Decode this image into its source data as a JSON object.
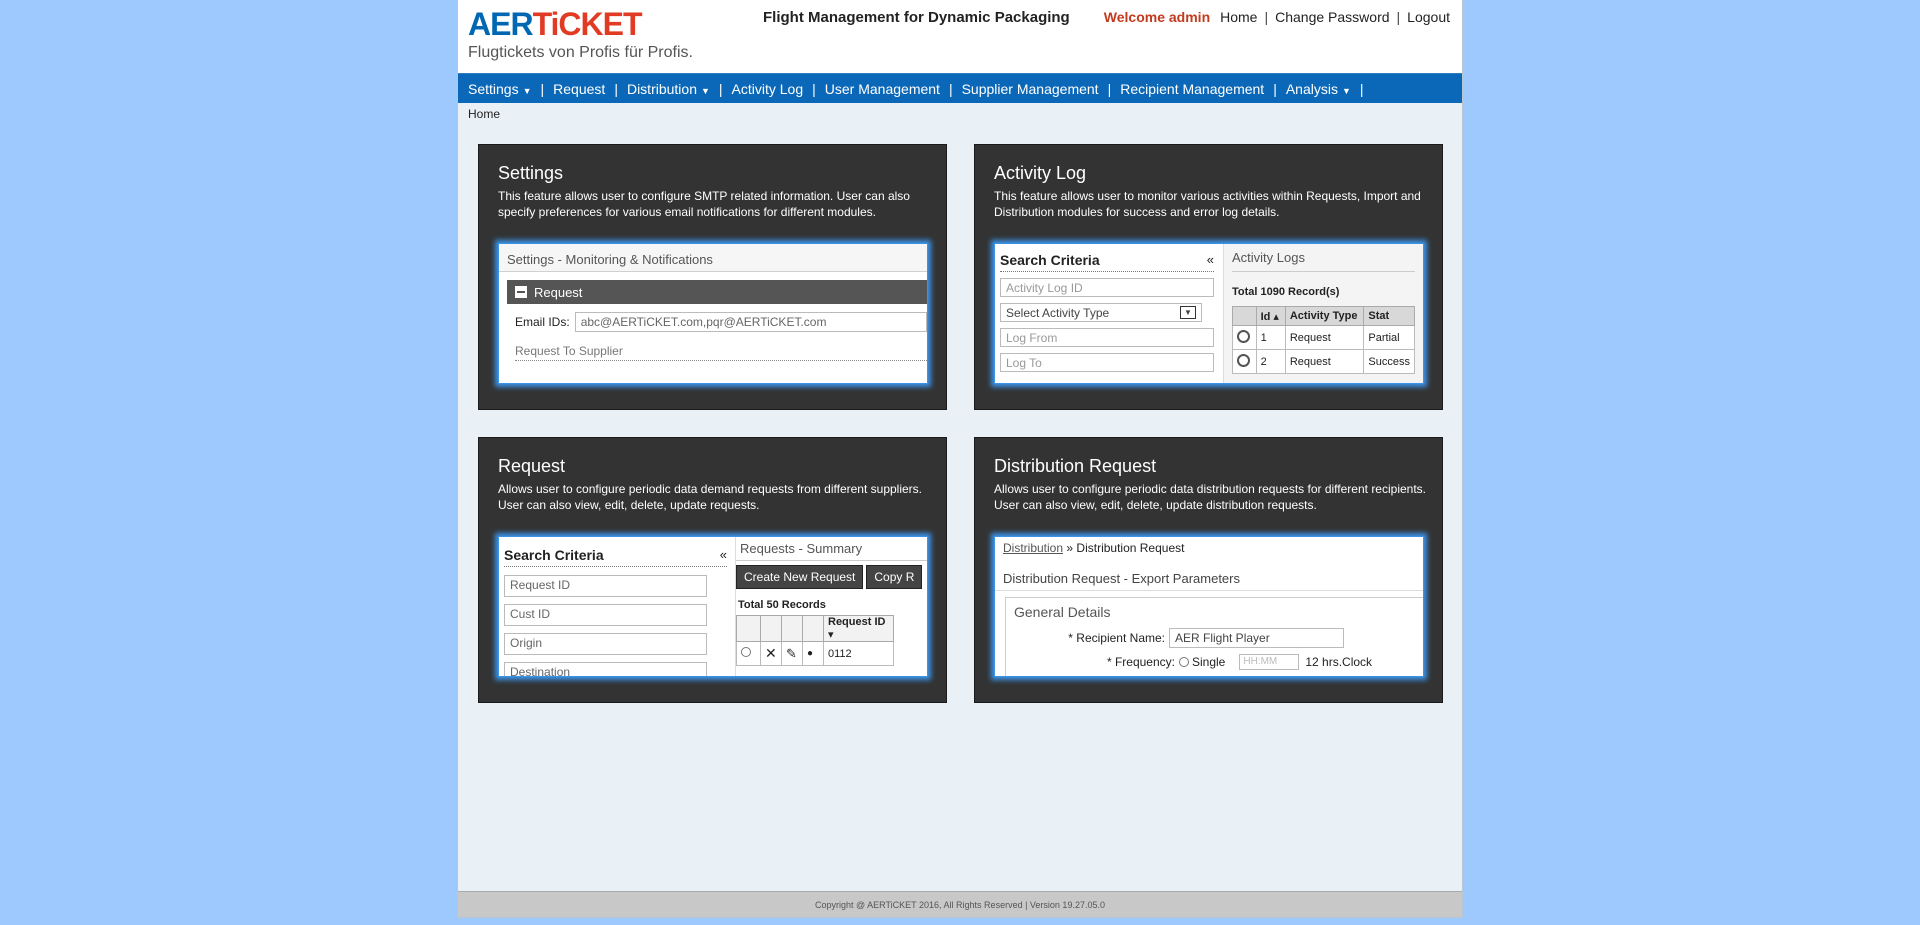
{
  "logo": {
    "word_a": "AER",
    "word_b": "TiCKET",
    "tagline": "Flugtickets von Profis für Profis."
  },
  "app_title": "Flight Management for Dynamic Packaging",
  "user_nav": {
    "welcome": "Welcome admin",
    "home": "Home",
    "change_password": "Change Password",
    "logout": "Logout"
  },
  "menu": {
    "settings": "Settings",
    "request": "Request",
    "distribution": "Distribution",
    "activity_log": "Activity Log",
    "user_management": "User Management",
    "supplier_management": "Supplier Management",
    "recipient_management": "Recipient Management",
    "analysis": "Analysis",
    "caret": "▼"
  },
  "breadcrumb": "Home",
  "cards": {
    "settings": {
      "title": "Settings",
      "desc": "This feature allows user to configure SMTP related information. User can also specify preferences for various email notifications for different modules.",
      "preview": {
        "title": "Settings - Monitoring & Notifications",
        "section": "Request",
        "email_label": "Email IDs:",
        "email_value": "abc@AERTiCKET.com,pqr@AERTiCKET.com",
        "sub": "Request To Supplier"
      }
    },
    "activity_log": {
      "title": "Activity Log",
      "desc": "This feature allows user to monitor various activities within Requests, Import and Distribution modules for success and error log details.",
      "preview": {
        "search_title": "Search Criteria",
        "collapse": "«",
        "log_id_ph": "Activity Log ID",
        "activity_type": "Select Activity Type",
        "log_from": "Log From",
        "log_to": "Log To",
        "right_title": "Activity Logs",
        "total": "Total 1090 Record(s)",
        "headers": [
          "Id ▴",
          "Activity Type",
          "Stat"
        ],
        "rows": [
          [
            "1",
            "Request",
            "Partial"
          ],
          [
            "2",
            "Request",
            "Success"
          ]
        ]
      }
    },
    "request": {
      "title": "Request",
      "desc": "Allows user to configure periodic data demand requests from different suppliers. User can also view, edit, delete, update requests.",
      "preview": {
        "search_title": "Search Criteria",
        "collapse": "«",
        "request_id": "Request ID",
        "cust_id": "Cust ID",
        "origin": "Origin",
        "destination": "Destination",
        "right_title": "Requests - Summary",
        "btn_create": "Create New Request",
        "btn_copy": "Copy R",
        "total": "Total 50 Records",
        "header_id": "Request ID ▾",
        "row_id": "0112"
      }
    },
    "distribution": {
      "title": "Distribution Request",
      "desc": "Allows user to configure periodic data distribution requests for different recipients. User can also view, edit, delete, update distribution requests.",
      "preview": {
        "bc_link": "Distribution",
        "bc_sep": "»",
        "bc_current": "Distribution Request",
        "title": "Distribution Request - Export Parameters",
        "section": "General Details",
        "recipient_label": "* Recipient Name:",
        "recipient_value": "AER Flight Player",
        "frequency_label": "* Frequency:",
        "frequency_opt": "Single",
        "time_ph": "HH:MM",
        "clock": "12 hrs.Clock"
      }
    }
  },
  "footer": "Copyright @ AERTiCKET 2016, All Rights Reserved | Version 19.27.05.0"
}
